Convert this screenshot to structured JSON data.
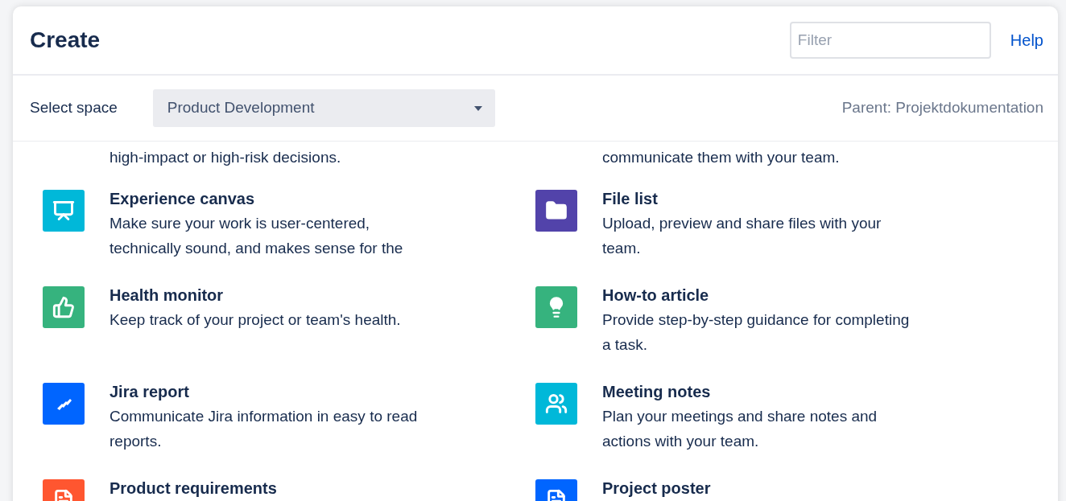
{
  "dialog": {
    "title": "Create",
    "filter": {
      "placeholder": "Filter"
    },
    "help_link": "Help"
  },
  "space_bar": {
    "label": "Select space",
    "space_select": {
      "value": "Product Development"
    },
    "parent": "Parent: Projektdokumentation"
  },
  "cut_off_lines": [
    "high-impact or high-risk decisions.",
    "communicate them with your team."
  ],
  "templates": [
    [
      {
        "title": "Experience canvas",
        "description": [
          "Make sure your work is user-centered,",
          "technically sound, and makes sense for the"
        ],
        "color": "#00b8d9"
      },
      {
        "title": "File list",
        "description": [
          "Upload, preview and share files with your",
          "team."
        ],
        "color": "#5243aa"
      }
    ],
    [
      {
        "title": "Health monitor",
        "description": [
          "Keep track of your project or team's health."
        ],
        "color": "#36b37e"
      },
      {
        "title": "How-to article",
        "description": [
          "Provide step-by-step guidance for completing",
          "a task."
        ],
        "color": "#36b37e"
      }
    ],
    [
      {
        "title": "Jira report",
        "description": [
          "Communicate Jira information in easy to read",
          "reports."
        ],
        "color": "#0065ff"
      },
      {
        "title": "Meeting notes",
        "description": [
          "Plan your meetings and share notes and",
          "actions with your team."
        ],
        "color": "#00b8d9"
      }
    ],
    [
      {
        "title": "Product requirements",
        "color": "#ff5630"
      },
      {
        "title": "Project poster",
        "color": "#0065ff"
      }
    ]
  ]
}
